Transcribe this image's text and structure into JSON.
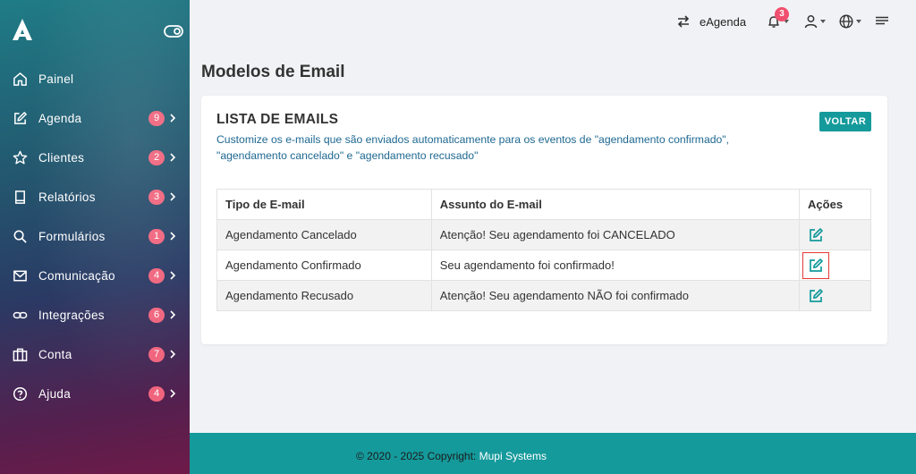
{
  "sidebar": {
    "items": [
      {
        "label": "Painel",
        "icon": "home-icon",
        "badge": null
      },
      {
        "label": "Agenda",
        "icon": "edit-icon",
        "badge": "9"
      },
      {
        "label": "Clientes",
        "icon": "star-icon",
        "badge": "2"
      },
      {
        "label": "Relatórios",
        "icon": "book-icon",
        "badge": "3"
      },
      {
        "label": "Formulários",
        "icon": "search-icon",
        "badge": "1"
      },
      {
        "label": "Comunicação",
        "icon": "mail-icon",
        "badge": "4"
      },
      {
        "label": "Integrações",
        "icon": "link-icon",
        "badge": "6"
      },
      {
        "label": "Conta",
        "icon": "briefcase-icon",
        "badge": "7"
      },
      {
        "label": "Ajuda",
        "icon": "help-circle-icon",
        "badge": "4"
      }
    ]
  },
  "topbar": {
    "app_label": "eAgenda",
    "notifications_count": "3"
  },
  "page": {
    "title": "Modelos de Email"
  },
  "card": {
    "title": "LISTA DE EMAILS",
    "description": "Customize os e-mails que são enviados automaticamente para os eventos de \"agendamento confirmado\", \"agendamento cancelado\" e \"agendamento recusado\"",
    "back_label": "VOLTAR"
  },
  "table": {
    "headers": [
      "Tipo de E-mail",
      "Assunto do E-mail",
      "Ações"
    ],
    "rows": [
      {
        "tipo": "Agendamento Cancelado",
        "assunto": "Atenção! Seu agendamento foi CANCELADO"
      },
      {
        "tipo": "Agendamento Confirmado",
        "assunto": "Seu agendamento foi confirmado!"
      },
      {
        "tipo": "Agendamento Recusado",
        "assunto": "Atenção! Seu agendamento NÃO foi confirmado"
      }
    ]
  },
  "footer": {
    "copyright": "© 2020 - 2025 Copyright: ",
    "company": "Mupi Systems"
  },
  "colors": {
    "accent": "#159a9c",
    "badge": "#f0647d",
    "description_text": "#1e6891"
  }
}
